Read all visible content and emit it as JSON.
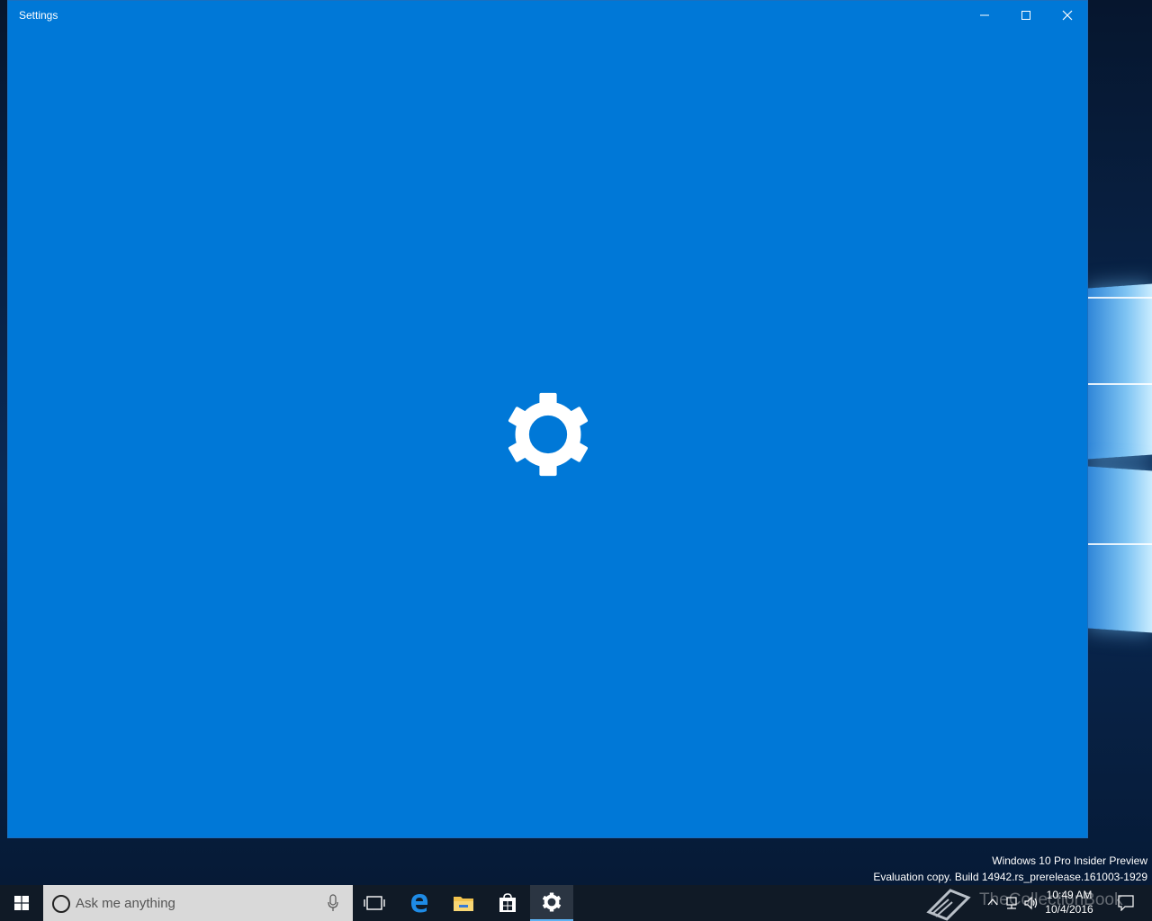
{
  "window": {
    "title": "Settings",
    "accent_color": "#0078d7",
    "splash_icon": "gear-icon",
    "controls": {
      "minimize_icon": "minimize-icon",
      "maximize_icon": "maximize-icon",
      "close_icon": "close-icon"
    }
  },
  "desktop": {
    "watermark_line1": "Windows 10 Pro Insider Preview",
    "watermark_line2": "Evaluation copy. Build 14942.rs_prerelease.161003-1929"
  },
  "taskbar": {
    "search_placeholder": "Ask me anything",
    "apps": [
      {
        "name": "task-view",
        "icon": "task-view-icon"
      },
      {
        "name": "edge",
        "icon": "edge-icon"
      },
      {
        "name": "file-explorer",
        "icon": "folder-icon"
      },
      {
        "name": "store",
        "icon": "store-icon"
      },
      {
        "name": "settings",
        "icon": "gear-icon",
        "active": true
      }
    ],
    "tray": {
      "overlay_text": "TheCollectionBook",
      "time": "10:49 AM",
      "date": "10/4/2016"
    }
  }
}
